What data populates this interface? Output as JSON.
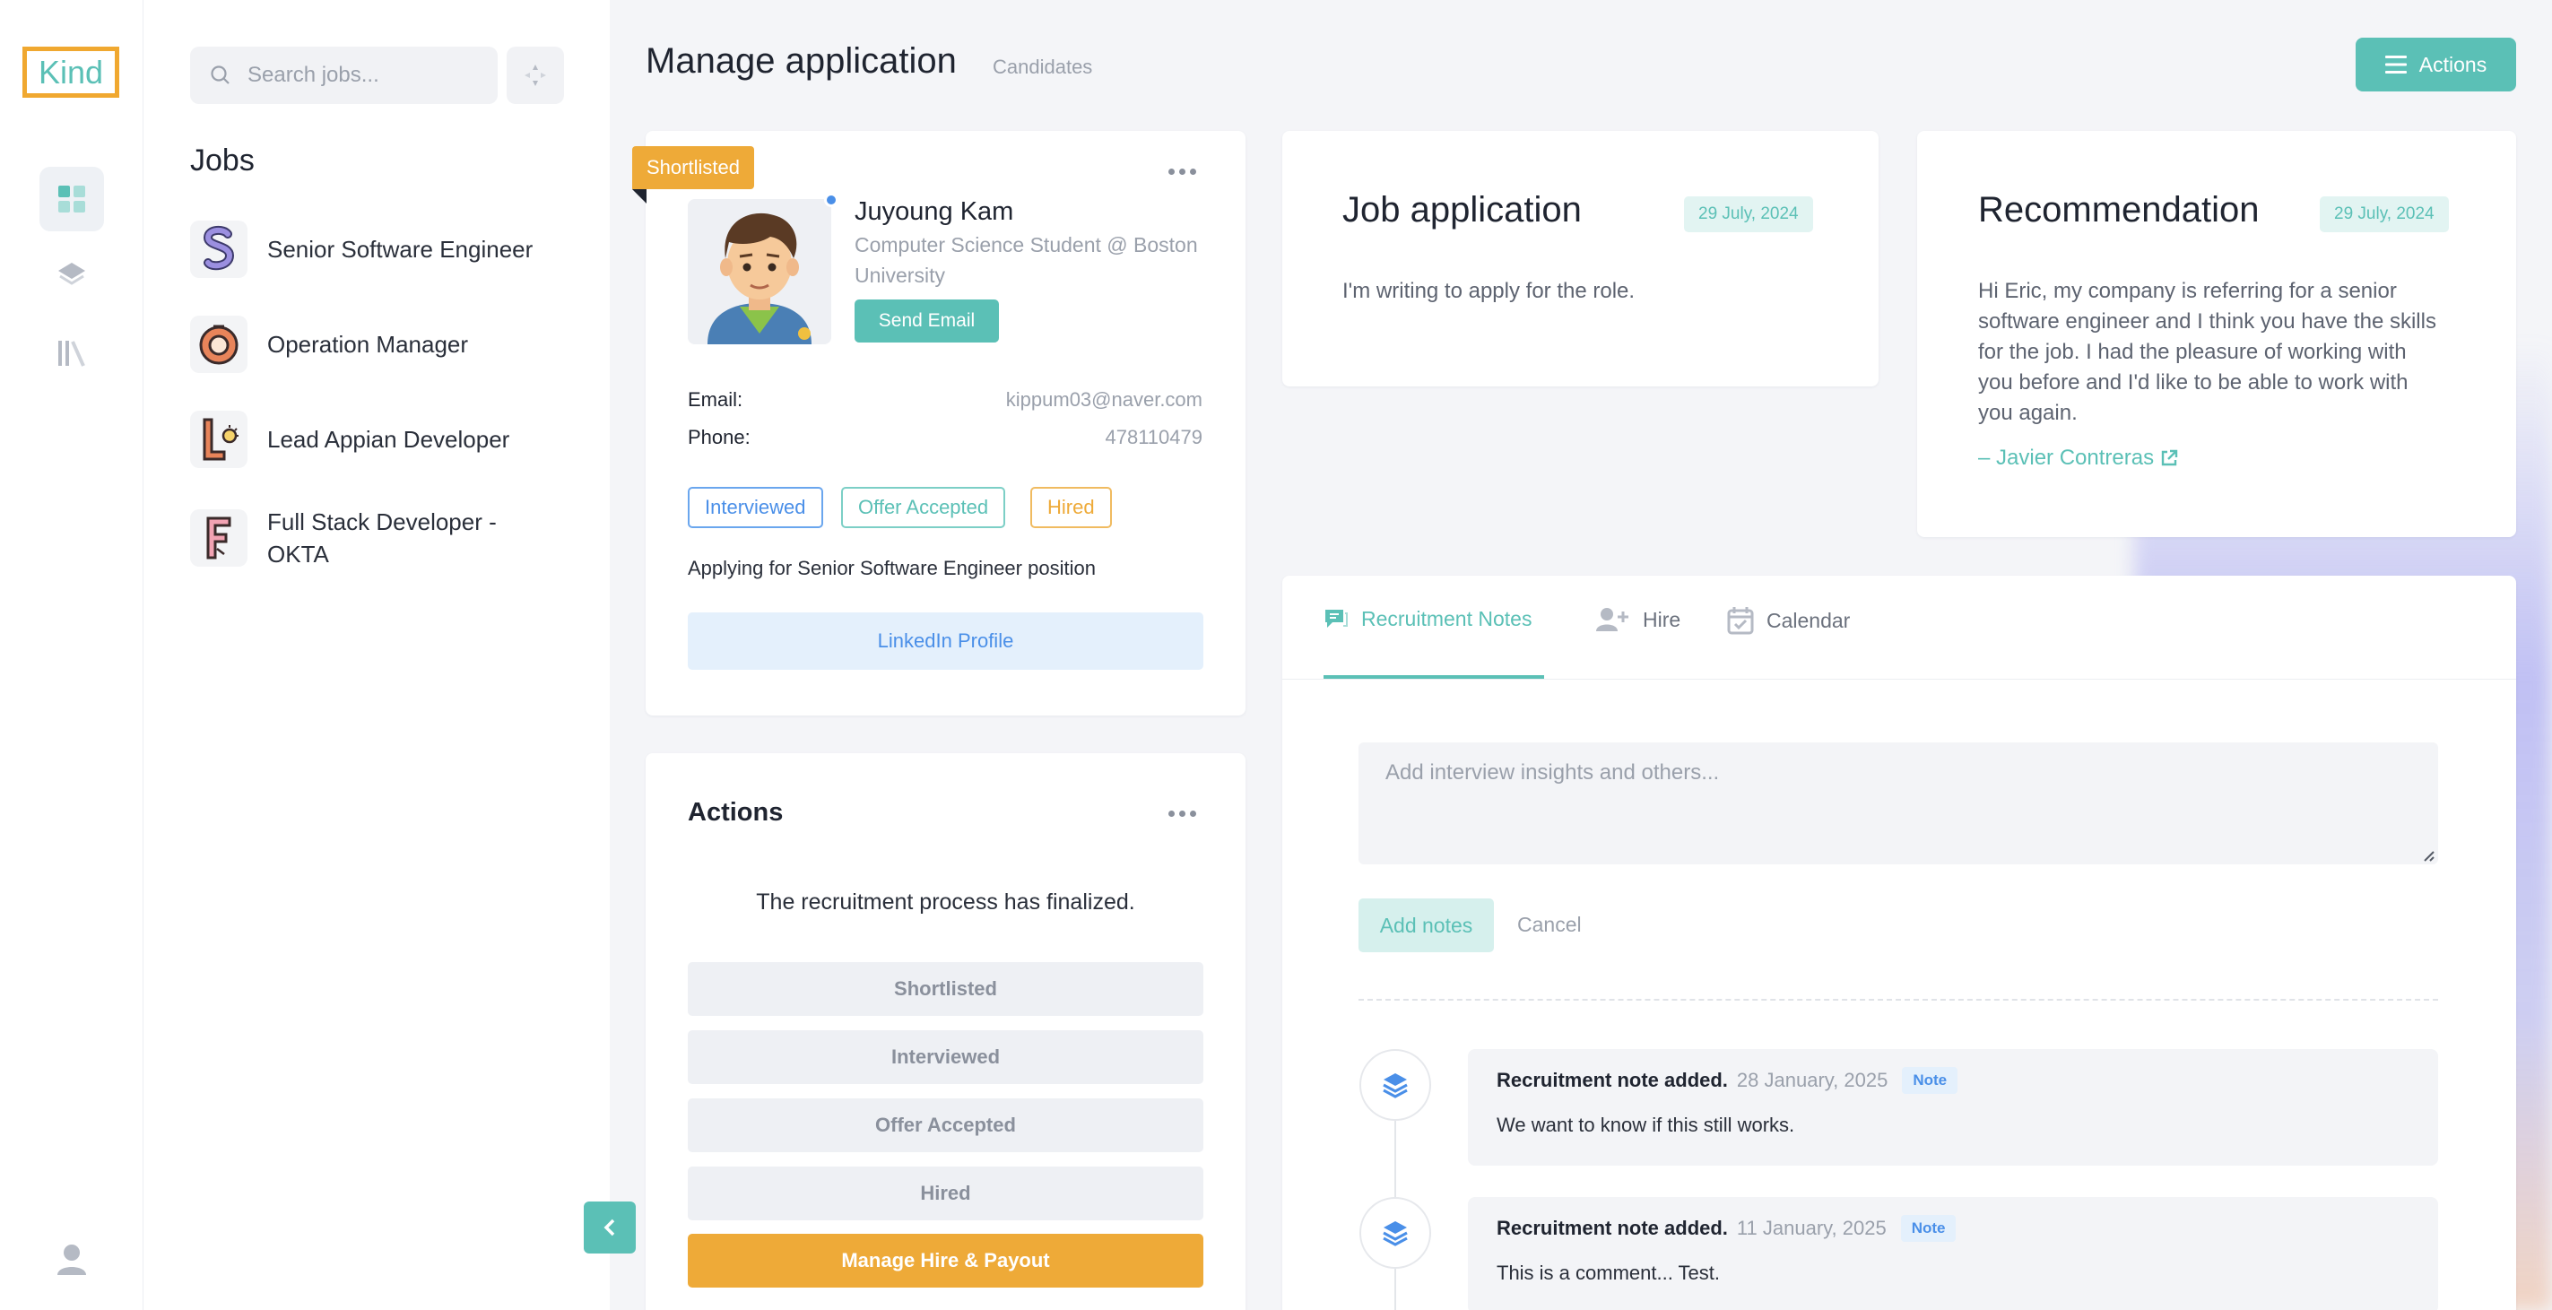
{
  "app": {
    "logo_text": "Kind"
  },
  "search": {
    "placeholder": "Search jobs..."
  },
  "jobs": {
    "title": "Jobs",
    "items": [
      {
        "label": "Senior Software Engineer"
      },
      {
        "label": "Operation Manager"
      },
      {
        "label": "Lead Appian Developer"
      },
      {
        "label": "Full Stack Developer - OKTA"
      }
    ]
  },
  "header": {
    "title": "Manage application",
    "subtitle": "Candidates",
    "actions_label": "Actions"
  },
  "candidate": {
    "status_tag": "Shortlisted",
    "name": "Juyoung Kam",
    "role": "Computer Science Student @ Boston University",
    "send_email_label": "Send Email",
    "email_label": "Email:",
    "email": "kippum03@naver.com",
    "phone_label": "Phone:",
    "phone": "478110479",
    "statuses": [
      "Interviewed",
      "Offer Accepted",
      "Hired"
    ],
    "applying_text": "Applying for Senior Software Engineer position",
    "linkedin_label": "LinkedIn Profile"
  },
  "actions_card": {
    "title": "Actions",
    "message": "The recruitment process has finalized.",
    "stages": [
      "Shortlisted",
      "Interviewed",
      "Offer Accepted",
      "Hired"
    ],
    "primary_label": "Manage Hire & Payout"
  },
  "job_application": {
    "title": "Job application",
    "date": "29 July, 2024",
    "text": "I'm writing to apply for the role."
  },
  "recommendation": {
    "title": "Recommendation",
    "date": "29 July, 2024",
    "text": "Hi Eric, my company is referring for a senior software engineer and I think you have the skills for the job. I had the pleasure of working with you before and I'd like to be able to work with you again.",
    "signature": "– Javier Contreras"
  },
  "notes": {
    "tabs": [
      "Recruitment Notes",
      "Hire",
      "Calendar"
    ],
    "placeholder": "Add interview insights and others...",
    "add_label": "Add notes",
    "cancel_label": "Cancel",
    "entries": [
      {
        "title": "Recruitment note added.",
        "date": "28 January, 2025",
        "badge": "Note",
        "body": "We want to know if this still works."
      },
      {
        "title": "Recruitment note added.",
        "date": "11 January, 2025",
        "badge": "Note",
        "body": "This is a comment... Test."
      }
    ]
  },
  "colors": {
    "accent": "#5bc0b6",
    "warning": "#eeaa38",
    "link": "#4a8fe8"
  }
}
